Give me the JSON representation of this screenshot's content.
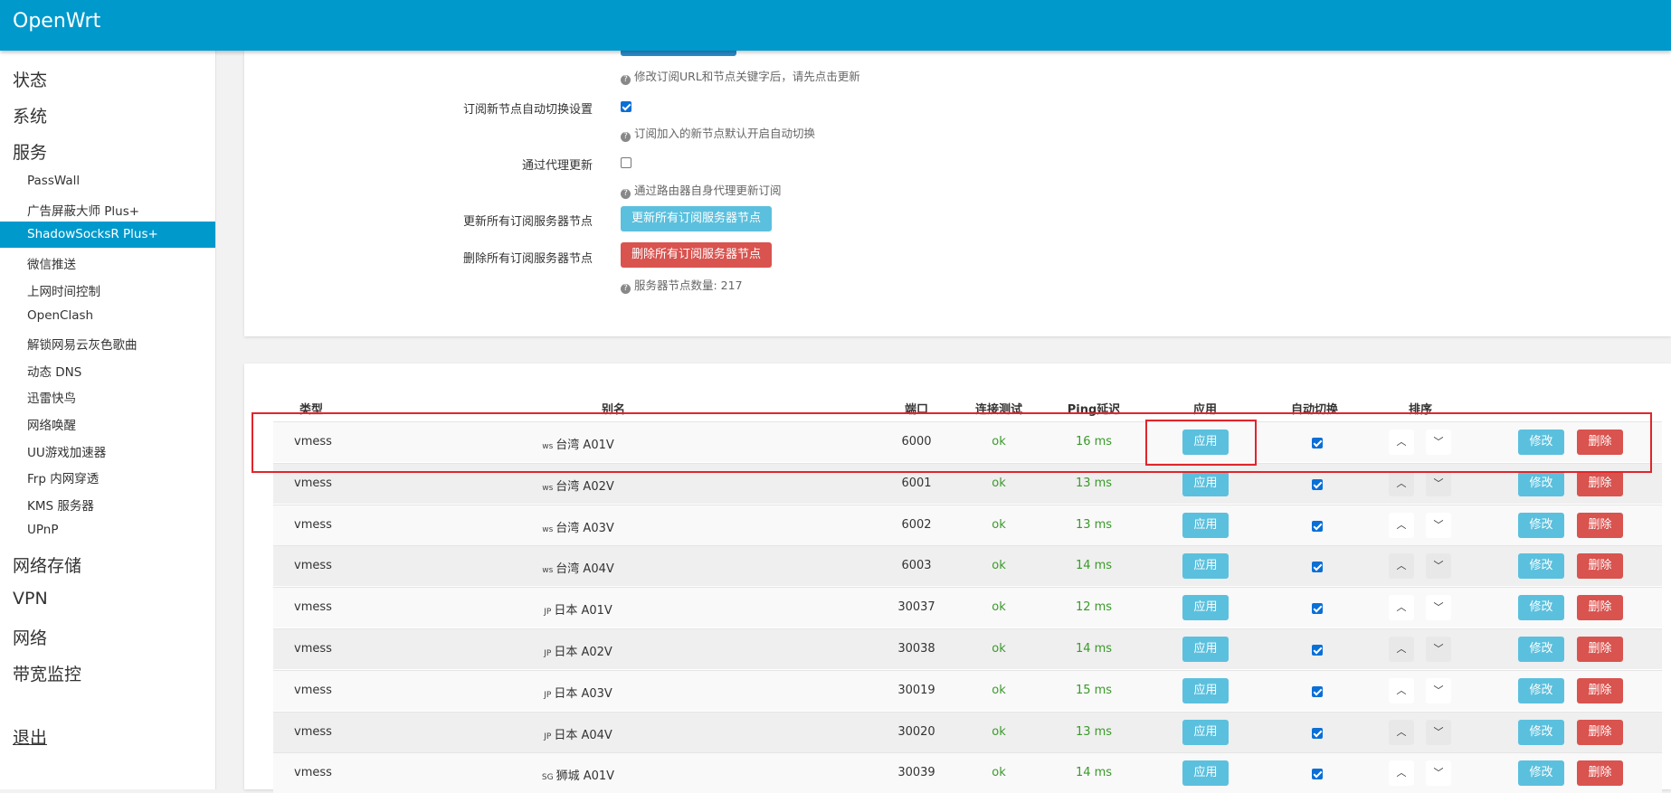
{
  "brand": "OpenWrt",
  "sidebar": {
    "top": [
      "状态",
      "系统",
      "服务"
    ],
    "services": [
      "PassWall",
      "广告屏蔽大师 Plus+",
      "ShadowSocksR Plus+",
      "微信推送",
      "上网时间控制",
      "OpenClash",
      "解锁网易云灰色歌曲",
      "动态 DNS",
      "迅雷快鸟",
      "网络唤醒",
      "UU游戏加速器",
      "Frp 内网穿透",
      "KMS 服务器",
      "UPnP"
    ],
    "bottom": [
      "网络存储",
      "VPN",
      "网络",
      "带宽监控"
    ],
    "logout": "退出"
  },
  "settings": {
    "hint_update": "修改订阅URL和节点关键字后，请先点击更新",
    "auto_switch_label": "订阅新节点自动切换设置",
    "auto_switch_hint": "订阅加入的新节点默认开启自动切换",
    "proxy_update_label": "通过代理更新",
    "proxy_update_hint": "通过路由器自身代理更新订阅",
    "update_all_label": "更新所有订阅服务器节点",
    "update_all_button": "更新所有订阅服务器节点",
    "delete_all_label": "删除所有订阅服务器节点",
    "delete_all_button": "删除所有订阅服务器节点",
    "node_count": "服务器节点数量: 217"
  },
  "table": {
    "headers": {
      "type": "类型",
      "alias": "别名",
      "port": "端口",
      "test": "连接测试",
      "ping": "Ping延迟",
      "apply": "应用",
      "auto": "自动切换",
      "sort": "排序"
    },
    "apply_label": "应用",
    "modify_label": "修改",
    "delete_label": "删除",
    "up_arrow": "︿",
    "down_arrow": "﹀",
    "rows": [
      {
        "type": "vmess",
        "flag": "ws",
        "alias": "台湾 A01V",
        "port": "6000",
        "test": "ok",
        "ping": "16 ms",
        "auto": true
      },
      {
        "type": "vmess",
        "flag": "ws",
        "alias": "台湾 A02V",
        "port": "6001",
        "test": "ok",
        "ping": "13 ms",
        "auto": true
      },
      {
        "type": "vmess",
        "flag": "ws",
        "alias": "台湾 A03V",
        "port": "6002",
        "test": "ok",
        "ping": "13 ms",
        "auto": true
      },
      {
        "type": "vmess",
        "flag": "ws",
        "alias": "台湾 A04V",
        "port": "6003",
        "test": "ok",
        "ping": "14 ms",
        "auto": true
      },
      {
        "type": "vmess",
        "flag": "JP",
        "alias": "日本 A01V",
        "port": "30037",
        "test": "ok",
        "ping": "12 ms",
        "auto": true
      },
      {
        "type": "vmess",
        "flag": "JP",
        "alias": "日本 A02V",
        "port": "30038",
        "test": "ok",
        "ping": "14 ms",
        "auto": true
      },
      {
        "type": "vmess",
        "flag": "JP",
        "alias": "日本 A03V",
        "port": "30019",
        "test": "ok",
        "ping": "15 ms",
        "auto": true
      },
      {
        "type": "vmess",
        "flag": "JP",
        "alias": "日本 A04V",
        "port": "30020",
        "test": "ok",
        "ping": "13 ms",
        "auto": true
      },
      {
        "type": "vmess",
        "flag": "SG",
        "alias": "狮城 A01V",
        "port": "30039",
        "test": "ok",
        "ping": "14 ms",
        "auto": true
      }
    ]
  },
  "colors": {
    "header": "#0099cc",
    "info": "#5bc0de",
    "danger": "#d9534f",
    "ok": "#3a9a2a",
    "annotation": "#e0262b"
  }
}
